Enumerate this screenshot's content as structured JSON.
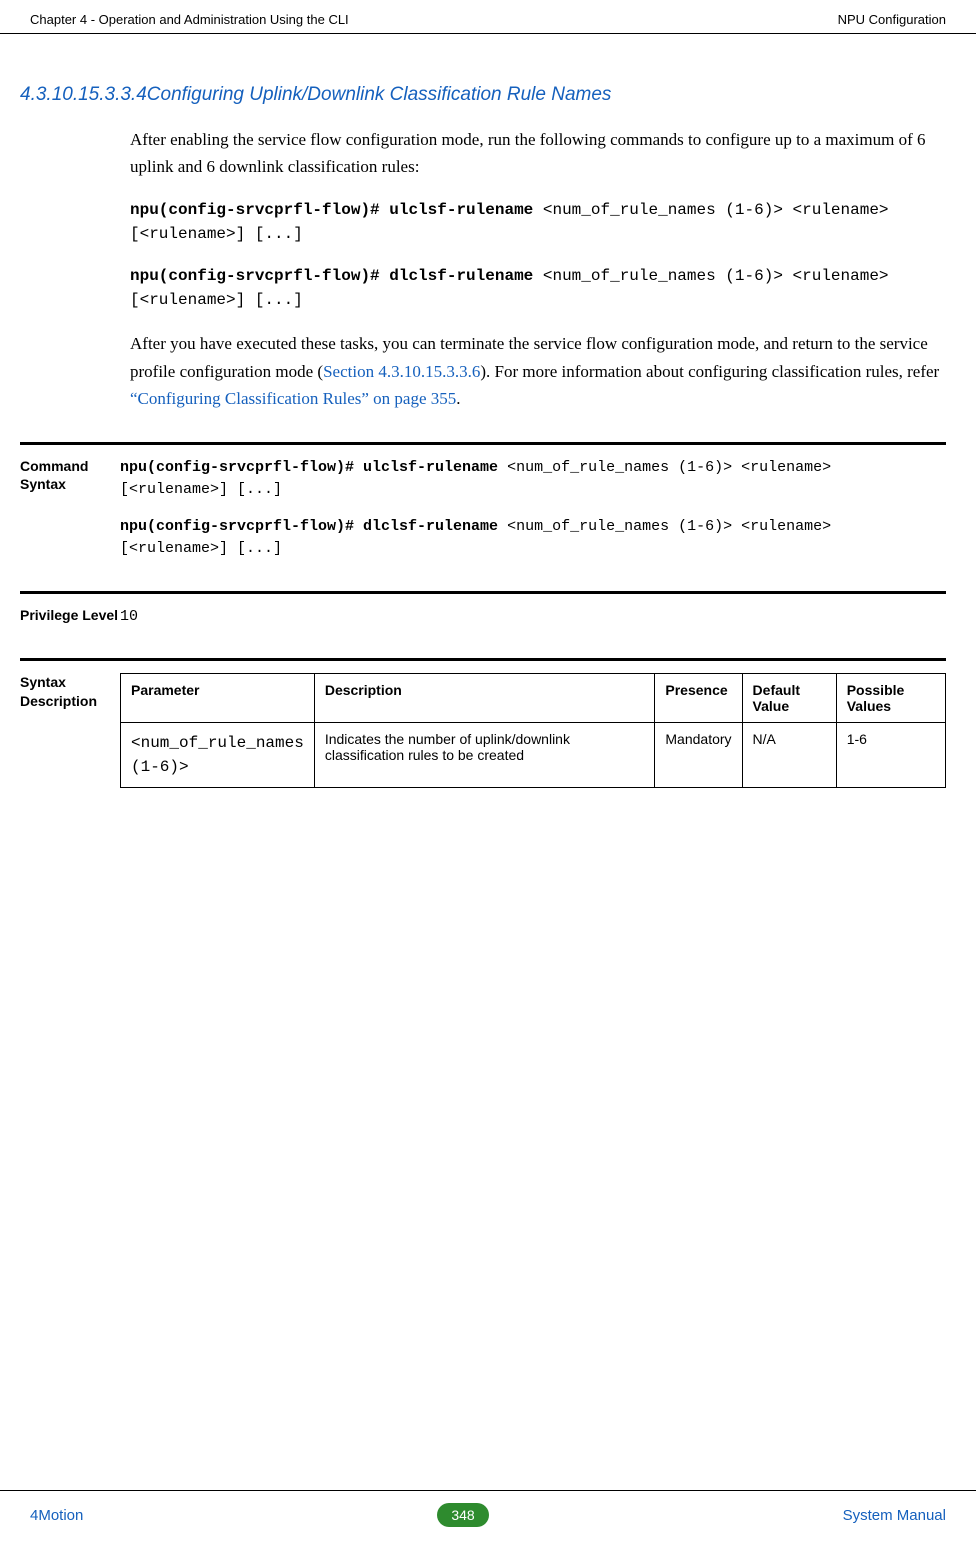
{
  "header": {
    "left": "Chapter 4 - Operation and Administration Using the CLI",
    "right": "NPU Configuration"
  },
  "section": {
    "number": "4.3.10.15.3.3.4",
    "title": "Configuring Uplink/Downlink Classification Rule Names"
  },
  "paragraphs": {
    "intro": "After enabling the service flow configuration mode, run the following commands to configure up to a maximum of 6 uplink and 6 downlink classification rules:",
    "cmd1_bold": "npu(config-srvcprfl-flow)# ulclsf-rulename ",
    "cmd1_rest": "<num_of_rule_names (1-6)> <rulename> [<rulename>] [...]",
    "cmd2_bold": "npu(config-srvcprfl-flow)# dlclsf-rulename ",
    "cmd2_rest": "<num_of_rule_names (1-6)> <rulename> [<rulename>] [...]",
    "after_pre": "After you have executed these tasks, you can terminate the service flow configuration mode, and return to the service profile configuration mode (",
    "after_link1": "Section 4.3.10.15.3.3.6",
    "after_mid": "). For more information about configuring classification rules, refer ",
    "after_link2": "“Configuring Classification Rules” on page 355",
    "after_end": "."
  },
  "command_syntax": {
    "label": "Command Syntax",
    "line1_bold": "npu(config-srvcprfl-flow)# ulclsf-rulename ",
    "line1_rest": "<num_of_rule_names (1-6)> <rulename> [<rulename>] [...]",
    "line2_bold": "npu(config-srvcprfl-flow)# dlclsf-rulename ",
    "line2_rest": "<num_of_rule_names (1-6)> <rulename> [<rulename>] [...]"
  },
  "privilege": {
    "label": "Privilege Level",
    "value": "10"
  },
  "syntax_description": {
    "label": "Syntax Description",
    "headers": {
      "parameter": "Parameter",
      "description": "Description",
      "presence": "Presence",
      "default": "Default Value",
      "possible": "Possible Values"
    },
    "row": {
      "parameter": "<num_of_rule_names (1-6)>",
      "description": "Indicates the number of uplink/downlink  classification rules to be created",
      "presence": "Mandatory",
      "default": "N/A",
      "possible": "1-6"
    }
  },
  "footer": {
    "left": "4Motion",
    "page": "348",
    "right": "System Manual"
  }
}
